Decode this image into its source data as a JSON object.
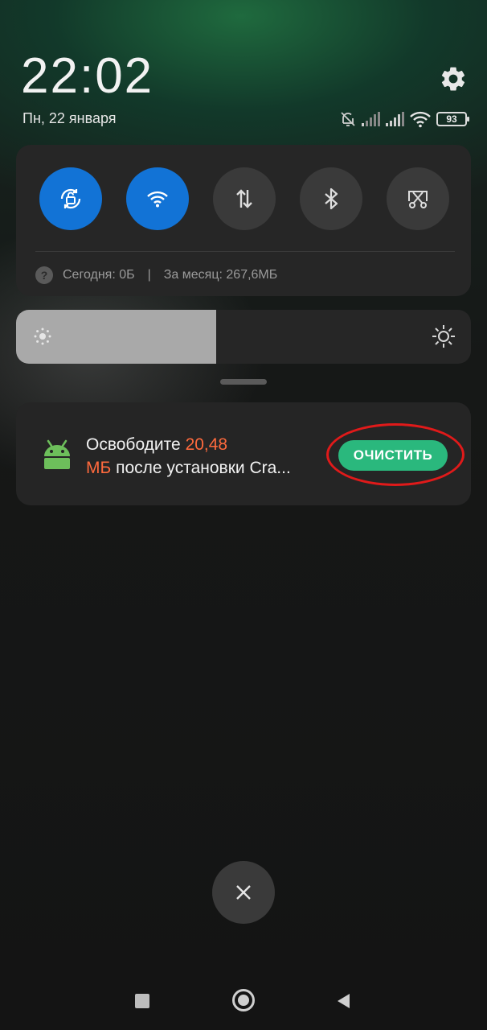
{
  "header": {
    "time": "22:02",
    "date": "Пн, 22 января",
    "battery_level": "93",
    "icons": [
      "gear-icon",
      "bell-muted-icon",
      "signal-icon",
      "signal-icon",
      "wifi-icon",
      "battery-icon"
    ]
  },
  "quick_toggles": [
    {
      "name": "auto-rotate",
      "icon": "rotate-lock-icon",
      "active": true
    },
    {
      "name": "wifi",
      "icon": "wifi-icon",
      "active": true
    },
    {
      "name": "mobile-data",
      "icon": "data-arrows-icon",
      "active": false
    },
    {
      "name": "bluetooth",
      "icon": "bluetooth-icon",
      "active": false
    },
    {
      "name": "screenshot",
      "icon": "screenshot-icon",
      "active": false
    }
  ],
  "usage": {
    "help_symbol": "?",
    "today": "Сегодня: 0Б",
    "separator": "|",
    "month": "За месяц: 267,6МБ"
  },
  "brightness": {
    "level": 0.44
  },
  "notification": {
    "text_part1": "Освободите ",
    "text_highlight1": "20,48",
    "text_highlight2": "МБ",
    "text_part2": " после установки Cra...",
    "action_label": "ОЧИСТИТЬ",
    "highlight_color": "#ff6a3d",
    "action_color": "#2ab87d",
    "annotation_color": "#e01a1a"
  },
  "colors": {
    "toggle_on": "#1273d6",
    "toggle_off": "#3a3a3a",
    "android_green": "#6dbf5b"
  }
}
